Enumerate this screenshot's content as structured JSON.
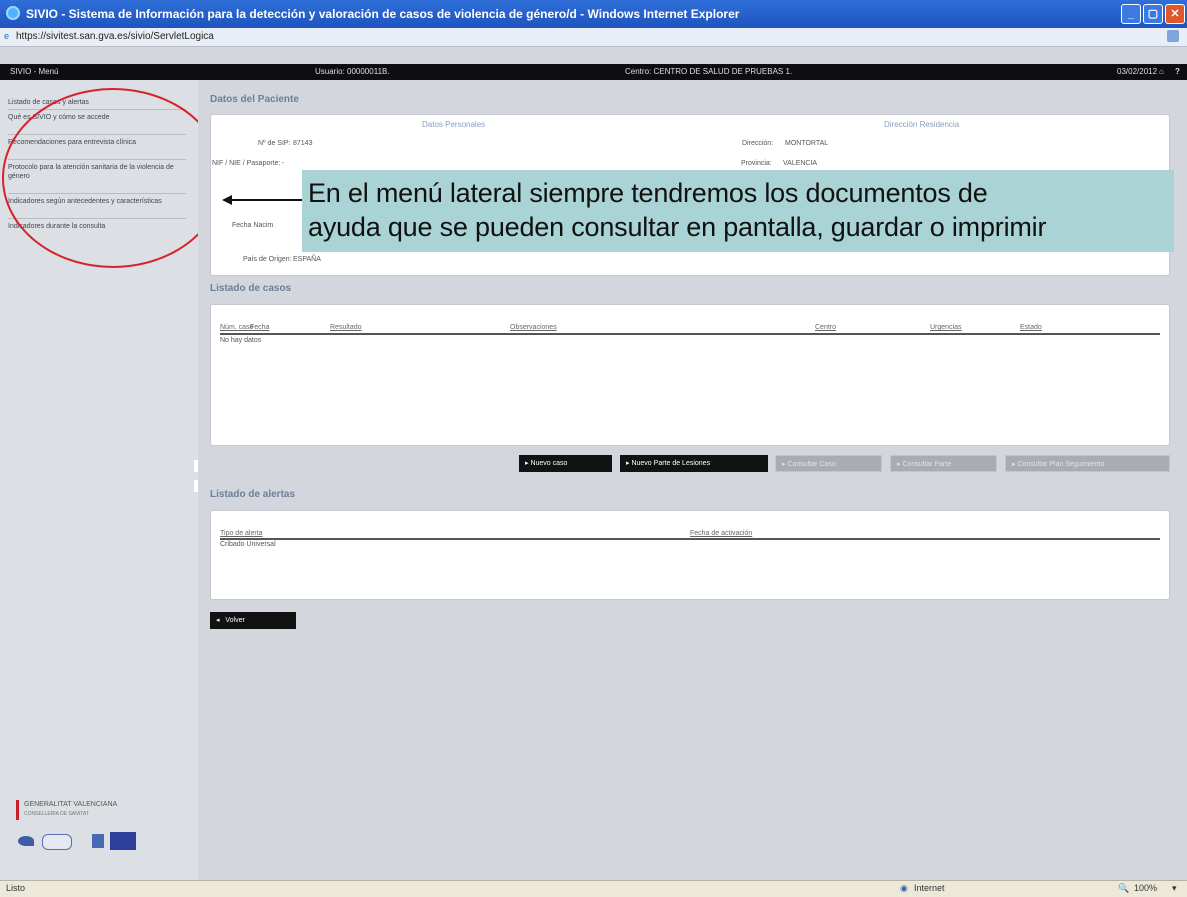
{
  "window": {
    "title": "SIVIO - Sistema de Información para la detección y valoración de casos de violencia de género/d - Windows Internet Explorer",
    "url": "https://sivitest.san.gva.es/sivio/ServletLogica"
  },
  "header": {
    "menu_label": "SIVIO - Menú",
    "user_label": "Usuario: 00000011B.",
    "center_label": "Centro: CENTRO DE SALUD DE PRUEBAS 1.",
    "date": "03/02/2012"
  },
  "sidebar": {
    "items": [
      "Listado de casos y alertas",
      "Qué es SIVIO y cómo se accede",
      "Recomendaciones para entrevista clínica",
      "Protocolo para la atención sanitaria de la violencia de género",
      "Indicadores según antecedentes y características",
      "Indicadores durante la consulta"
    ],
    "logo_text_1": "GENERALITAT VALENCIANA",
    "logo_text_2": "CONSELLERIA DE SANITAT"
  },
  "patient": {
    "section_title": "Datos del Paciente",
    "personal_title": "Datos Personales",
    "residence_title": "Dirección Residencia",
    "sip_label": "Nº de SIP:",
    "sip_value": "87143",
    "dni_label": "NIF / NIE / Pasaporte:",
    "dni_value": "-",
    "birth_label": "Fecha Nacim",
    "origin_label": "País de Origen:",
    "origin_value": "ESPAÑA",
    "address_label": "Dirección:",
    "address_value": "MONTORTAL",
    "province_label": "Provincia:",
    "province_value": "VALENCIA"
  },
  "cases": {
    "section_title": "Listado de casos",
    "columns": [
      "Núm. caso",
      "Fecha",
      "Resultado",
      "Observaciones",
      "Centro",
      "Urgencias",
      "Estado"
    ],
    "empty_text": "No hay datos"
  },
  "buttons": {
    "nuevo_caso": "Nuevo caso",
    "nuevo_parte": "Nuevo Parte de Lesiones",
    "consultar_caso": "Consultar Caso",
    "consultar_parte": "Consultar Parte",
    "consultar_plan": "Consultar Plan Seguimiento",
    "volver": "Volver"
  },
  "alerts": {
    "section_title": "Listado de alertas",
    "col_tipo": "Tipo de alerta",
    "col_fecha": "Fecha de activación",
    "row_value": "Cribado Universal"
  },
  "callout": {
    "line1": "En el menú lateral siempre tendremos los documentos de",
    "line2": "ayuda que se pueden consultar en pantalla, guardar o imprimir"
  },
  "statusbar": {
    "left": "Listo",
    "zone": "Internet",
    "zoom": "100%"
  }
}
